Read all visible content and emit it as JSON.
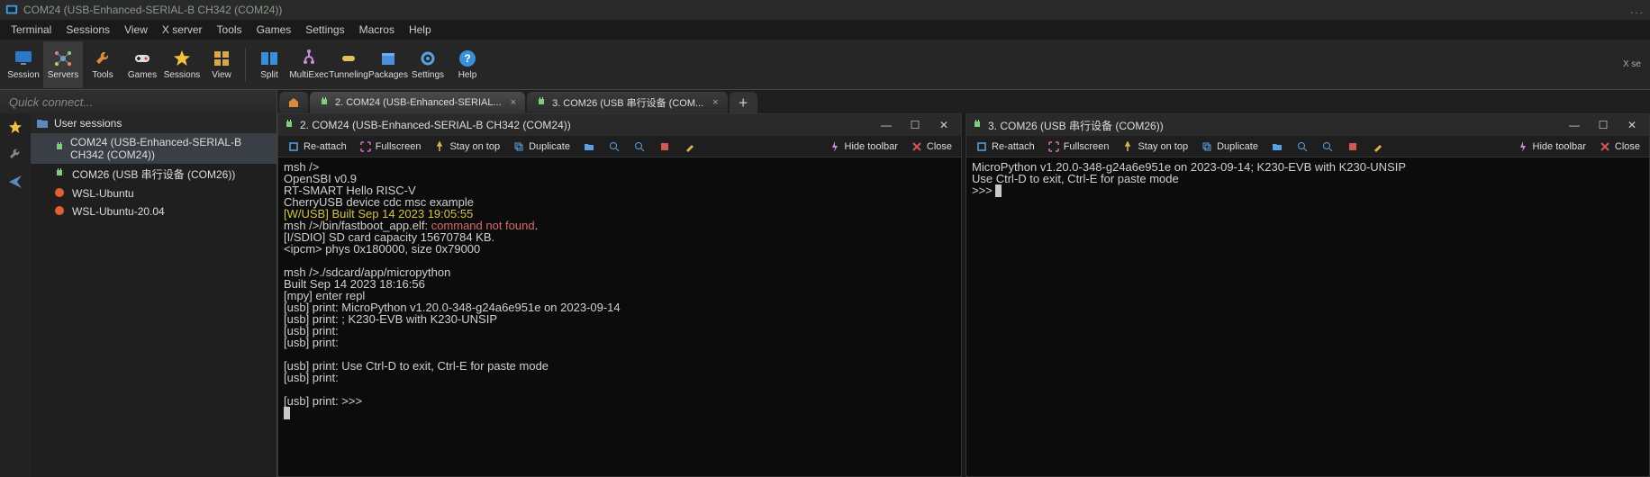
{
  "window": {
    "title": "COM24   (USB-Enhanced-SERIAL-B CH342 (COM24))",
    "dots": "..."
  },
  "menu": [
    "Terminal",
    "Sessions",
    "View",
    "X server",
    "Tools",
    "Games",
    "Settings",
    "Macros",
    "Help"
  ],
  "ribbon": {
    "items": [
      {
        "label": "Session"
      },
      {
        "label": "Servers"
      },
      {
        "label": "Tools"
      },
      {
        "label": "Games"
      },
      {
        "label": "Sessions"
      },
      {
        "label": "View"
      },
      {
        "label": "Split"
      },
      {
        "label": "MultiExec"
      },
      {
        "label": "Tunneling"
      },
      {
        "label": "Packages"
      },
      {
        "label": "Settings"
      },
      {
        "label": "Help"
      }
    ],
    "right": "X se"
  },
  "quick_connect": "Quick connect...",
  "tabs": [
    {
      "label": ""
    },
    {
      "label": "2. COM24   (USB-Enhanced-SERIAL..."
    },
    {
      "label": "3. COM26   (USB 串行设备 (COM..."
    }
  ],
  "sidebar": {
    "header": "User sessions",
    "items": [
      {
        "label": "COM24  (USB-Enhanced-SERIAL-B CH342 (COM24))"
      },
      {
        "label": "COM26  (USB 串行设备 (COM26))"
      },
      {
        "label": "WSL-Ubuntu"
      },
      {
        "label": "WSL-Ubuntu-20.04"
      }
    ]
  },
  "winA": {
    "title": "2. COM24   (USB-Enhanced-SERIAL-B CH342 (COM24))",
    "toolbar": {
      "reattach": "Re-attach",
      "fullscreen": "Fullscreen",
      "stayontop": "Stay on top",
      "duplicate": "Duplicate",
      "hide": "Hide toolbar",
      "close": "Close"
    },
    "lines": [
      {
        "t": "msh />"
      },
      {
        "t": "OpenSBI v0.9"
      },
      {
        "t": "RT-SMART Hello RISC-V"
      },
      {
        "t": "CherryUSB device cdc msc example"
      },
      {
        "t": "[W/USB] Built Sep 14 2023 19:05:55",
        "cls": "yellow"
      },
      {
        "pre": "msh />/bin/fastboot_app.elf: ",
        "red": "command not found",
        "post": "."
      },
      {
        "t": "[I/SDIO] SD card capacity 15670784 KB."
      },
      {
        "t": "<ipcm> phys 0x180000, size 0x79000"
      },
      {
        "t": ""
      },
      {
        "t": "msh />./sdcard/app/micropython"
      },
      {
        "t": "Built Sep 14 2023 18:16:56"
      },
      {
        "t": "[mpy] enter repl"
      },
      {
        "t": "[usb] print: MicroPython v1.20.0-348-g24a6e951e on 2023-09-14"
      },
      {
        "t": "[usb] print: ; K230-EVB with K230-UNSIP"
      },
      {
        "t": "[usb] print:"
      },
      {
        "t": "[usb] print:"
      },
      {
        "t": ""
      },
      {
        "t": "[usb] print: Use Ctrl-D to exit, Ctrl-E for paste mode"
      },
      {
        "t": "[usb] print:"
      },
      {
        "t": ""
      },
      {
        "t": "[usb] print: >>>"
      }
    ]
  },
  "winB": {
    "title": "3. COM26   (USB 串行设备 (COM26))",
    "toolbar": {
      "reattach": "Re-attach",
      "fullscreen": "Fullscreen",
      "stayontop": "Stay on top",
      "duplicate": "Duplicate",
      "hide": "Hide toolbar",
      "close": "Close"
    },
    "lines": [
      {
        "t": "MicroPython v1.20.0-348-g24a6e951e on 2023-09-14; K230-EVB with K230-UNSIP"
      },
      {
        "t": "Use Ctrl-D to exit, Ctrl-E for paste mode"
      },
      {
        "t": ">>> "
      }
    ]
  }
}
